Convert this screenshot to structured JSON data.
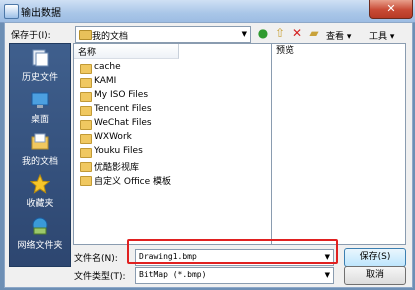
{
  "window": {
    "title": "输出数据",
    "close": "✕"
  },
  "save_in": {
    "label": "保存于(I):",
    "value": "我的文档"
  },
  "toolbar": {
    "view_label": "查看",
    "tools_label": "工具"
  },
  "places": [
    {
      "label": "历史文件"
    },
    {
      "label": "桌面"
    },
    {
      "label": "我的文档"
    },
    {
      "label": "收藏夹"
    },
    {
      "label": "网络文件夹"
    }
  ],
  "list": {
    "column_name": "名称",
    "items": [
      "cache",
      "KAMI",
      "My ISO Files",
      "Tencent Files",
      "WeChat Files",
      "WXWork",
      "Youku Files",
      "优酷影视库",
      "自定义 Office 模板"
    ]
  },
  "preview": {
    "label": "预览"
  },
  "filename": {
    "label": "文件名(N):",
    "value": "Drawing1.bmp"
  },
  "filetype": {
    "label": "文件类型(T):",
    "value": "BitMap (*.bmp)"
  },
  "buttons": {
    "save": "保存(S)",
    "cancel": "取消"
  }
}
